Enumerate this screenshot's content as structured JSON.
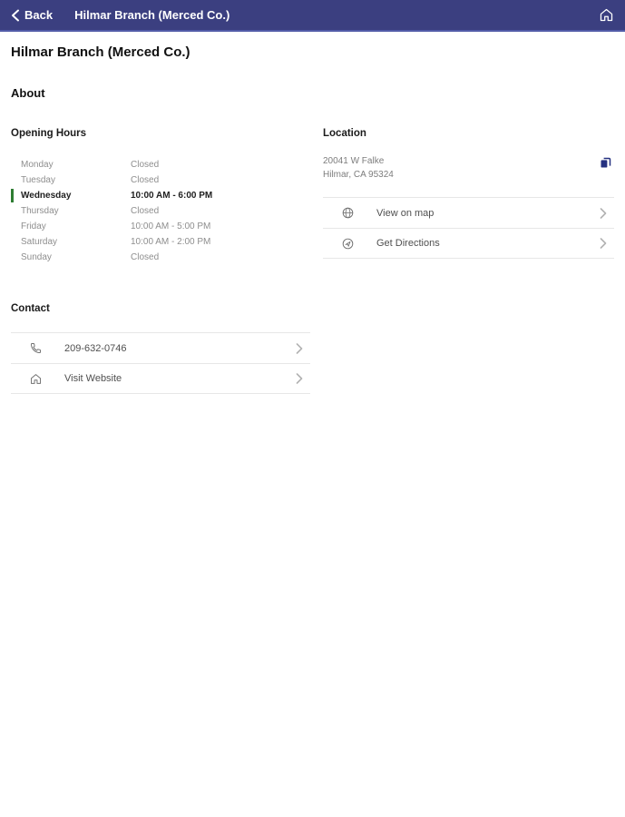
{
  "header": {
    "back_label": "Back",
    "title": "Hilmar Branch (Merced Co.)",
    "bg_color": "#3b3f80"
  },
  "page": {
    "title": "Hilmar Branch (Merced Co.)",
    "about_label": "About"
  },
  "opening_hours": {
    "title": "Opening Hours",
    "current_day_color": "#2e7d32",
    "rows": [
      {
        "day": "Monday",
        "hours": "Closed",
        "current": false
      },
      {
        "day": "Tuesday",
        "hours": "Closed",
        "current": false
      },
      {
        "day": "Wednesday",
        "hours": "10:00 AM - 6:00 PM",
        "current": true
      },
      {
        "day": "Thursday",
        "hours": "Closed",
        "current": false
      },
      {
        "day": "Friday",
        "hours": "10:00 AM - 5:00 PM",
        "current": false
      },
      {
        "day": "Saturday",
        "hours": "10:00 AM - 2:00 PM",
        "current": false
      },
      {
        "day": "Sunday",
        "hours": "Closed",
        "current": false
      }
    ]
  },
  "location": {
    "title": "Location",
    "address_line1": "20041 W Falke",
    "address_line2": "Hilmar, CA 95324",
    "copy_icon_color": "#253180",
    "actions": [
      {
        "label": "View on map",
        "icon": "globe-icon"
      },
      {
        "label": "Get Directions",
        "icon": "directions-icon"
      }
    ]
  },
  "contact": {
    "title": "Contact",
    "actions": [
      {
        "label": "209-632-0746",
        "icon": "phone-icon"
      },
      {
        "label": "Visit Website",
        "icon": "website-icon"
      }
    ]
  }
}
